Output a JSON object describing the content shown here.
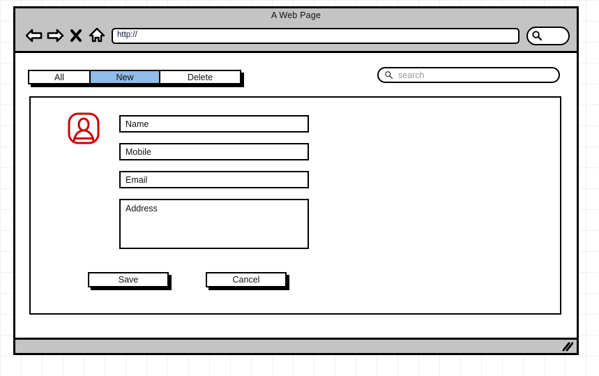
{
  "browser": {
    "title": "A Web Page",
    "url_value": "http://",
    "nav": {
      "back_icon": "back-arrow-icon",
      "forward_icon": "forward-arrow-icon",
      "stop_icon": "close-x-icon",
      "home_icon": "home-icon"
    },
    "search_button_icon": "search-icon"
  },
  "page": {
    "tabs": [
      {
        "label": "All",
        "selected": false
      },
      {
        "label": "New",
        "selected": true
      },
      {
        "label": "Delete",
        "selected": false
      }
    ],
    "search": {
      "icon": "search-icon",
      "placeholder": "search",
      "value": ""
    },
    "avatar_icon": "user-avatar-icon",
    "form": {
      "fields": [
        {
          "label": "Name",
          "type": "text"
        },
        {
          "label": "Mobile",
          "type": "text"
        },
        {
          "label": "Email",
          "type": "text"
        },
        {
          "label": "Address",
          "type": "textarea"
        }
      ],
      "buttons": [
        {
          "label": "Save"
        },
        {
          "label": "Cancel"
        }
      ]
    }
  },
  "status_bar": {
    "resize_grip_icon": "resize-grip-icon"
  },
  "colors": {
    "selected_tab": "#8fbce8",
    "avatar_red": "#cc0000",
    "chrome_gray": "#c4c4c4",
    "outline": "#000000",
    "placeholder_gray": "#9a9a9a"
  }
}
